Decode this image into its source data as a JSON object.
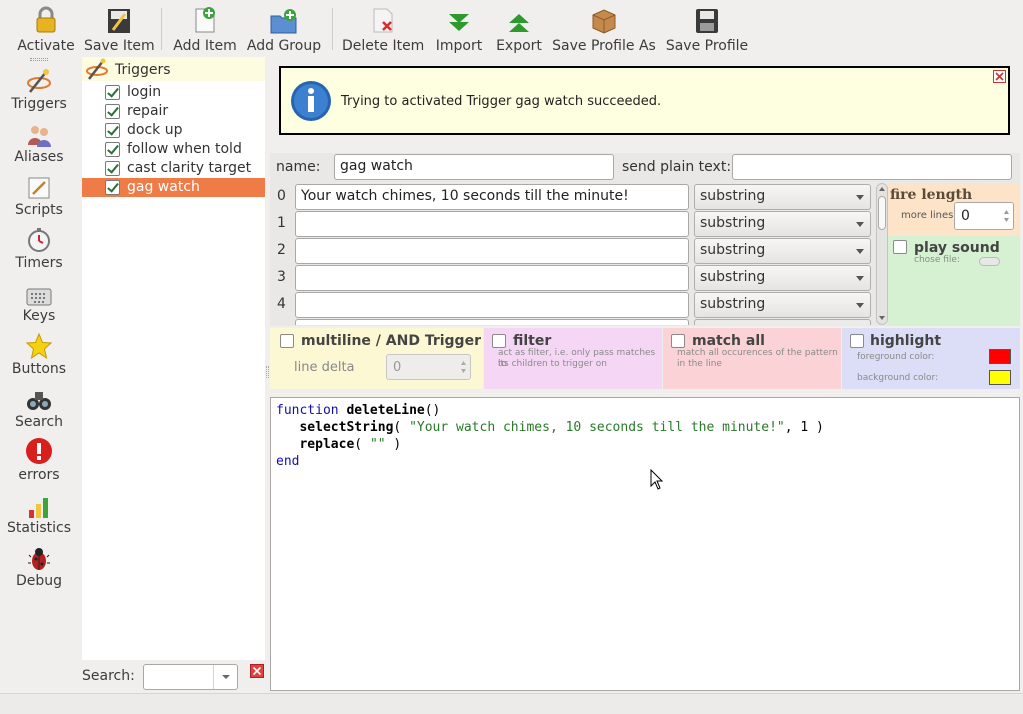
{
  "toolbar": {
    "activate": "Activate",
    "save_item": "Save Item",
    "add_item": "Add Item",
    "add_group": "Add Group",
    "delete_item": "Delete Item",
    "import": "Import",
    "export": "Export",
    "save_profile_as": "Save Profile As",
    "save_profile": "Save Profile"
  },
  "nav": {
    "triggers": "Triggers",
    "aliases": "Aliases",
    "scripts": "Scripts",
    "timers": "Timers",
    "keys": "Keys",
    "buttons": "Buttons",
    "search": "Search",
    "errors": "errors",
    "statistics": "Statistics",
    "debug": "Debug"
  },
  "tree": {
    "root": "Triggers",
    "items": [
      {
        "label": "login"
      },
      {
        "label": "repair"
      },
      {
        "label": "dock up"
      },
      {
        "label": "follow when told"
      },
      {
        "label": "cast clarity target"
      },
      {
        "label": "gag watch"
      }
    ]
  },
  "search": {
    "label": "Search:",
    "value": ""
  },
  "banner": {
    "message": "Trying to activated Trigger gag watch succeeded."
  },
  "form": {
    "name_label": "name:",
    "name_value": "gag watch",
    "plain_label": "send plain text:",
    "plain_value": ""
  },
  "patterns": [
    {
      "index": "0",
      "text": "Your watch chimes, 10 seconds till the minute!",
      "type": "substring"
    },
    {
      "index": "1",
      "text": "",
      "type": "substring"
    },
    {
      "index": "2",
      "text": "",
      "type": "substring"
    },
    {
      "index": "3",
      "text": "",
      "type": "substring"
    },
    {
      "index": "4",
      "text": "",
      "type": "substring"
    }
  ],
  "fire": {
    "title": "fire length",
    "more_lines_label": "more lines",
    "more_lines_value": "0",
    "play_sound": "play sound",
    "chose_file": "chose file:"
  },
  "options": {
    "multiline": "multiline / AND Trigger",
    "line_delta_label": "line delta",
    "line_delta_value": "0",
    "filter": "filter",
    "filter_desc_1": "act as filter, i.e. only pass matches to",
    "filter_desc_2": "its children to trigger on",
    "match_all": "match all",
    "match_desc_1": "match all occurences of the pattern",
    "match_desc_2": "in the line",
    "highlight": "highlight",
    "fg_label": "foreground color:",
    "bg_label": "background color:",
    "fg_color": "#ff0000",
    "bg_color": "#ffff00"
  },
  "code": {
    "l1_kw": "function",
    "l1_name": "deleteLine",
    "l1_rest": "()",
    "l2_fn": "selectString",
    "l2_open": "( ",
    "l2_str": "\"Your watch chimes, 10 seconds till the minute!\"",
    "l2_rest": ", 1 )",
    "l3_fn": "replace",
    "l3_open": "( ",
    "l3_str": "\"\"",
    "l3_rest": " )",
    "l4_kw": "end"
  },
  "colors": {
    "selection": "#ef7b47",
    "banner_bg": "#fefee0",
    "fire_bg": "#fde4c8",
    "sound_bg": "#d6f0d2",
    "multiline_bg": "#fdf8d4",
    "filter_bg": "#f5d7f5",
    "matchall_bg": "#fbd3d6",
    "highlight_bg": "#dcddf7"
  }
}
